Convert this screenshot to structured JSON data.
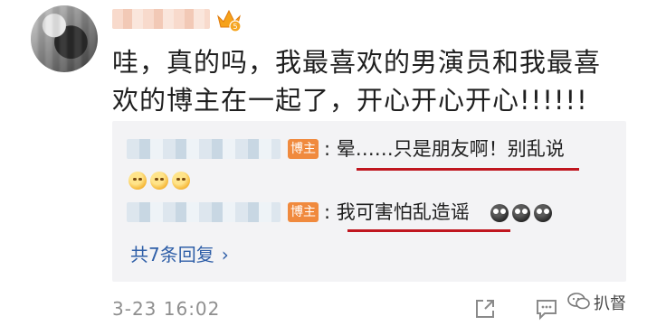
{
  "post": {
    "text": "哇，真的吗，我最喜欢的男演员和我最喜欢的博主在一起了，开心开心开心!!!!!!",
    "timestamp": "3-23 16:02"
  },
  "vip_badge": {
    "level": "5"
  },
  "replies": [
    {
      "tag": "博主",
      "text": ": 晕……只是朋友啊！别乱说"
    },
    {
      "tag": "博主",
      "text": ": 我可害怕乱造谣"
    }
  ],
  "reply_count_label": "共7条回复",
  "chevron": "›",
  "watermark": "扒督",
  "icons": {
    "share": "share-icon",
    "comment": "comment-icon",
    "wechat": "wechat-logo-icon"
  },
  "colors": {
    "accent_tag": "#f08a3e",
    "link": "#2f5fa8",
    "underline": "#c0161f"
  }
}
